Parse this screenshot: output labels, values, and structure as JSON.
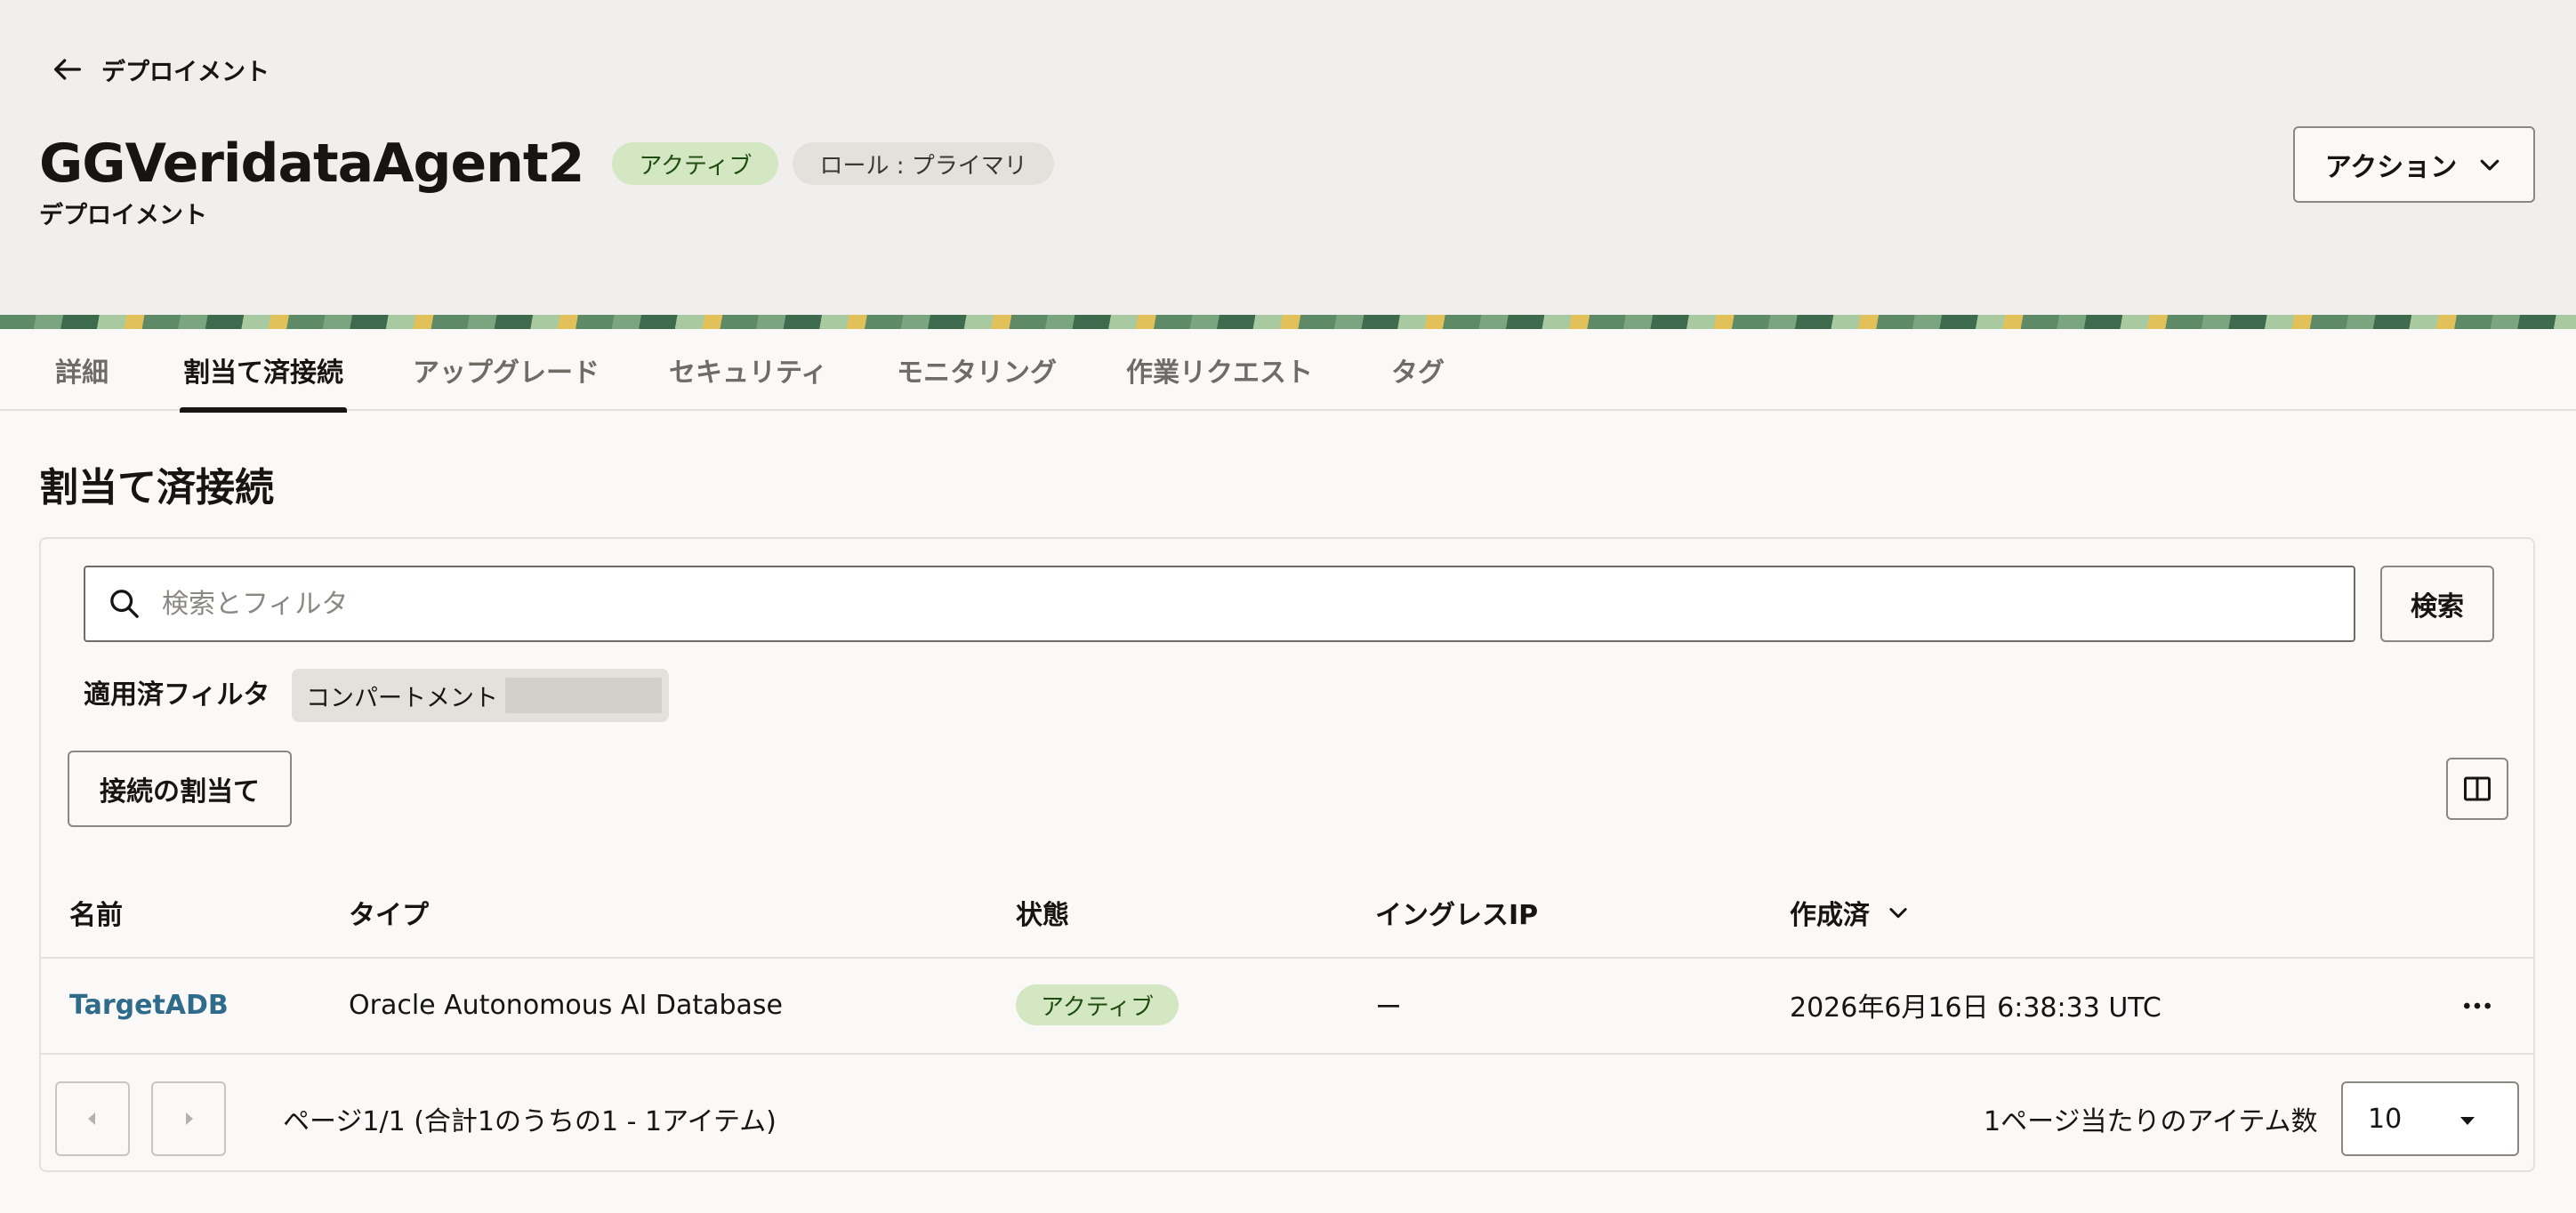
{
  "header": {
    "back_label": "デプロイメント",
    "title": "GGVeridataAgent2",
    "badge_status": "アクティブ",
    "badge_role": "ロール : プライマリ",
    "subtitle": "デプロイメント",
    "actions_label": "アクション"
  },
  "tabs": [
    {
      "label": "詳細"
    },
    {
      "label": "割当て済接続"
    },
    {
      "label": "アップグレード"
    },
    {
      "label": "セキュリティ"
    },
    {
      "label": "モニタリング"
    },
    {
      "label": "作業リクエスト"
    },
    {
      "label": "タグ"
    }
  ],
  "active_tab": "割当て済接続",
  "section": {
    "title": "割当て済接続",
    "search_placeholder": "検索とフィルタ",
    "search_button": "検索",
    "applied_filters_label": "適用済フィルタ",
    "filter_chip": "コンパートメント",
    "assign_button": "接続の割当て"
  },
  "table": {
    "columns": [
      "名前",
      "タイプ",
      "状態",
      "イングレスIP",
      "作成済"
    ],
    "rows": [
      {
        "name": "TargetADB",
        "type": "Oracle Autonomous AI Database",
        "state": "アクティブ",
        "ingress_ip": "ー",
        "created": "2026年6月16日 6:38:33 UTC"
      }
    ]
  },
  "pagination": {
    "summary": "ページ1/1 (合計1のうちの1 - 1アイテム)",
    "items_per_page_label": "1ページ当たりのアイテム数",
    "items_per_page": "10"
  },
  "colors": {
    "active_badge_bg": "#d4e7c3",
    "link": "#2f6b8a",
    "header_bg": "#f1efed"
  }
}
